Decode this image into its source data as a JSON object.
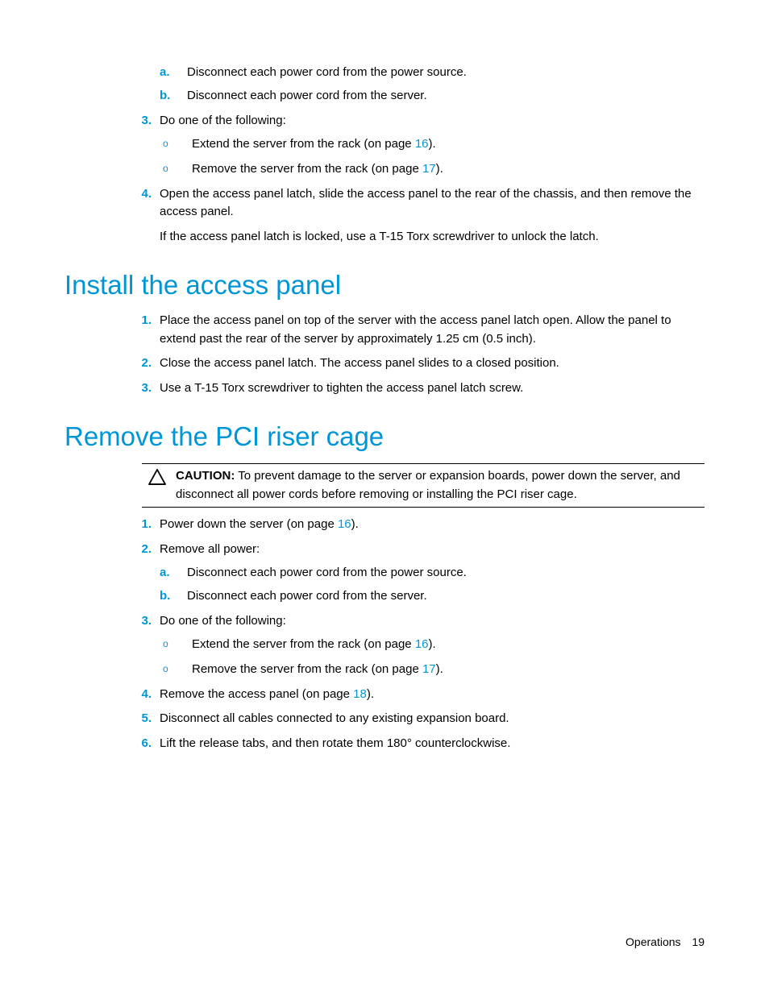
{
  "sections": {
    "top": {
      "items": {
        "a": "Disconnect each power cord from the power source.",
        "b": "Disconnect each power cord from the server.",
        "step3": "Do one of the following:",
        "extend_pre": "Extend the server from the rack (on page ",
        "extend_link": "16",
        "extend_post": ").",
        "remove_pre": "Remove the server from the rack (on page ",
        "remove_link": "17",
        "remove_post": ").",
        "step4": "Open the access panel latch, slide the access panel to the rear of the chassis, and then remove the access panel.",
        "step4_extra": "If the access panel latch is locked, use a T-15 Torx screwdriver to unlock the latch."
      }
    },
    "install": {
      "title": "Install the access panel",
      "s1": "Place the access panel on top of the server with the access panel latch open. Allow the panel to extend past the rear of the server by approximately 1.25 cm (0.5 inch).",
      "s2": "Close the access panel latch. The access panel slides to a closed position.",
      "s3": "Use a T-15 Torx screwdriver to tighten the access panel latch screw."
    },
    "remove": {
      "title": "Remove the PCI riser cage",
      "caution_label": "CAUTION:",
      "caution_text": " To prevent damage to the server or expansion boards, power down the server, and disconnect all power cords before removing or installing the PCI riser cage.",
      "s1_pre": "Power down the server (on page ",
      "s1_link": "16",
      "s1_post": ").",
      "s2": "Remove all power:",
      "s2a": "Disconnect each power cord from the power source.",
      "s2b": "Disconnect each power cord from the server.",
      "s3": "Do one of the following:",
      "extend_pre": "Extend the server from the rack (on page ",
      "extend_link": "16",
      "extend_post": ").",
      "removerack_pre": "Remove the server from the rack (on page ",
      "removerack_link": "17",
      "removerack_post": ").",
      "s4_pre": "Remove the access panel (on page ",
      "s4_link": "18",
      "s4_post": ").",
      "s5": "Disconnect all cables connected to any existing expansion board.",
      "s6": "Lift the release tabs, and then rotate them 180° counterclockwise."
    }
  },
  "markers": {
    "n1": "1.",
    "n2": "2.",
    "n3": "3.",
    "n4": "4.",
    "n5": "5.",
    "n6": "6.",
    "a": "a.",
    "b": "b.",
    "circ": "o"
  },
  "footer": {
    "section": "Operations",
    "page": "19"
  }
}
